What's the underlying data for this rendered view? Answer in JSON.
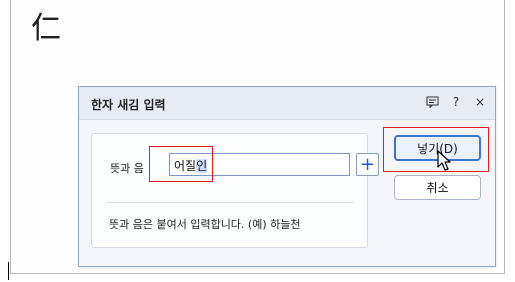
{
  "document": {
    "character": "仁"
  },
  "dialog": {
    "title": "한자 새김 입력",
    "title_icons": [
      "memo-icon",
      "help-icon",
      "close-icon"
    ],
    "help_label": "?",
    "close_label": "×",
    "field_label": "뜻과 음",
    "input_value_unselected": "어질",
    "input_value_selected": "인",
    "plus_label": "+",
    "hint": "뜻과 음은 붙여서 입력합니다. (예) 하늘천",
    "insert_button": "넣기(D)",
    "cancel_button": "취소"
  },
  "colors": {
    "highlight_box": "#e02020",
    "accent": "#3f73d4",
    "dialog_border": "#8ea6c9",
    "titlebar_bg": "#e6ebf4"
  }
}
